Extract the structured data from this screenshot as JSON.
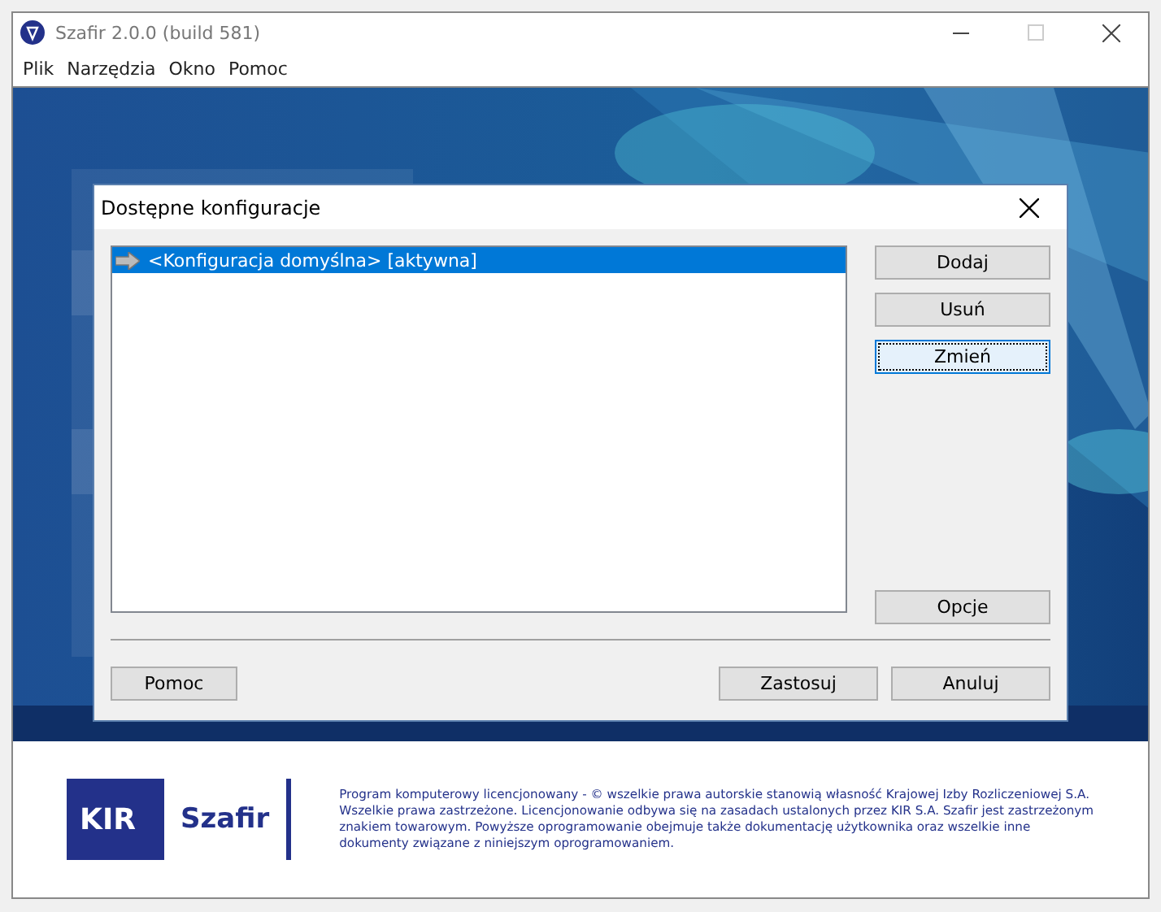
{
  "window": {
    "title": "Szafir 2.0.0 (build 581)"
  },
  "menu": [
    "Plik",
    "Narzędzia",
    "Okno",
    "Pomoc"
  ],
  "dialog": {
    "title": "Dostępne konfiguracje",
    "items": [
      {
        "label": "<Konfiguracja domyślna> [aktywna]",
        "selected": true
      }
    ],
    "side_buttons": [
      {
        "label": "Dodaj",
        "focused": false
      },
      {
        "label": "Usuń",
        "focused": false
      },
      {
        "label": "Zmień",
        "focused": true
      }
    ],
    "options_button": "Opcje",
    "help_button": "Pomoc",
    "bottom_buttons": [
      "Zastosuj",
      "Anuluj"
    ]
  },
  "footer": {
    "logo_kir": "KIR",
    "logo_product": "Szafir",
    "legal": "Program komputerowy licencjonowany - © wszelkie prawa autorskie stanowią własność Krajowej Izby Rozliczeniowej S.A. Wszelkie prawa zastrzeżone. Licencjonowanie odbywa się na zasadach ustalonych przez KIR S.A. Szafir jest zastrzeżonym znakiem towarowym. Powyższe oprogramowanie obejmuje także dokumentację użytkownika oraz wszelkie inne dokumenty związane z niniejszym oprogramowaniem."
  }
}
